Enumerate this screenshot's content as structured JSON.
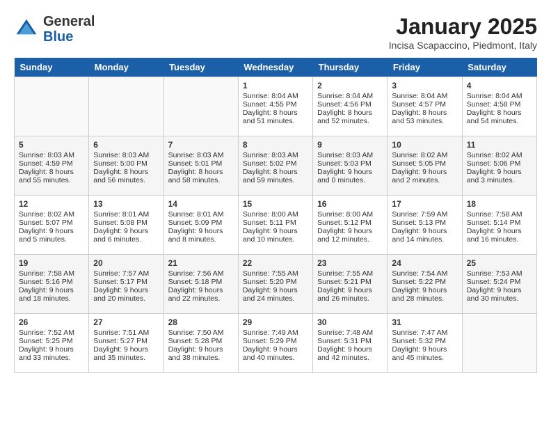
{
  "header": {
    "logo_general": "General",
    "logo_blue": "Blue",
    "month_title": "January 2025",
    "location": "Incisa Scapaccino, Piedmont, Italy"
  },
  "days_of_week": [
    "Sunday",
    "Monday",
    "Tuesday",
    "Wednesday",
    "Thursday",
    "Friday",
    "Saturday"
  ],
  "weeks": [
    [
      {
        "day": "",
        "info": ""
      },
      {
        "day": "",
        "info": ""
      },
      {
        "day": "",
        "info": ""
      },
      {
        "day": "1",
        "info": "Sunrise: 8:04 AM\nSunset: 4:55 PM\nDaylight: 8 hours and 51 minutes."
      },
      {
        "day": "2",
        "info": "Sunrise: 8:04 AM\nSunset: 4:56 PM\nDaylight: 8 hours and 52 minutes."
      },
      {
        "day": "3",
        "info": "Sunrise: 8:04 AM\nSunset: 4:57 PM\nDaylight: 8 hours and 53 minutes."
      },
      {
        "day": "4",
        "info": "Sunrise: 8:04 AM\nSunset: 4:58 PM\nDaylight: 8 hours and 54 minutes."
      }
    ],
    [
      {
        "day": "5",
        "info": "Sunrise: 8:03 AM\nSunset: 4:59 PM\nDaylight: 8 hours and 55 minutes."
      },
      {
        "day": "6",
        "info": "Sunrise: 8:03 AM\nSunset: 5:00 PM\nDaylight: 8 hours and 56 minutes."
      },
      {
        "day": "7",
        "info": "Sunrise: 8:03 AM\nSunset: 5:01 PM\nDaylight: 8 hours and 58 minutes."
      },
      {
        "day": "8",
        "info": "Sunrise: 8:03 AM\nSunset: 5:02 PM\nDaylight: 8 hours and 59 minutes."
      },
      {
        "day": "9",
        "info": "Sunrise: 8:03 AM\nSunset: 5:03 PM\nDaylight: 9 hours and 0 minutes."
      },
      {
        "day": "10",
        "info": "Sunrise: 8:02 AM\nSunset: 5:05 PM\nDaylight: 9 hours and 2 minutes."
      },
      {
        "day": "11",
        "info": "Sunrise: 8:02 AM\nSunset: 5:06 PM\nDaylight: 9 hours and 3 minutes."
      }
    ],
    [
      {
        "day": "12",
        "info": "Sunrise: 8:02 AM\nSunset: 5:07 PM\nDaylight: 9 hours and 5 minutes."
      },
      {
        "day": "13",
        "info": "Sunrise: 8:01 AM\nSunset: 5:08 PM\nDaylight: 9 hours and 6 minutes."
      },
      {
        "day": "14",
        "info": "Sunrise: 8:01 AM\nSunset: 5:09 PM\nDaylight: 9 hours and 8 minutes."
      },
      {
        "day": "15",
        "info": "Sunrise: 8:00 AM\nSunset: 5:11 PM\nDaylight: 9 hours and 10 minutes."
      },
      {
        "day": "16",
        "info": "Sunrise: 8:00 AM\nSunset: 5:12 PM\nDaylight: 9 hours and 12 minutes."
      },
      {
        "day": "17",
        "info": "Sunrise: 7:59 AM\nSunset: 5:13 PM\nDaylight: 9 hours and 14 minutes."
      },
      {
        "day": "18",
        "info": "Sunrise: 7:58 AM\nSunset: 5:14 PM\nDaylight: 9 hours and 16 minutes."
      }
    ],
    [
      {
        "day": "19",
        "info": "Sunrise: 7:58 AM\nSunset: 5:16 PM\nDaylight: 9 hours and 18 minutes."
      },
      {
        "day": "20",
        "info": "Sunrise: 7:57 AM\nSunset: 5:17 PM\nDaylight: 9 hours and 20 minutes."
      },
      {
        "day": "21",
        "info": "Sunrise: 7:56 AM\nSunset: 5:18 PM\nDaylight: 9 hours and 22 minutes."
      },
      {
        "day": "22",
        "info": "Sunrise: 7:55 AM\nSunset: 5:20 PM\nDaylight: 9 hours and 24 minutes."
      },
      {
        "day": "23",
        "info": "Sunrise: 7:55 AM\nSunset: 5:21 PM\nDaylight: 9 hours and 26 minutes."
      },
      {
        "day": "24",
        "info": "Sunrise: 7:54 AM\nSunset: 5:22 PM\nDaylight: 9 hours and 28 minutes."
      },
      {
        "day": "25",
        "info": "Sunrise: 7:53 AM\nSunset: 5:24 PM\nDaylight: 9 hours and 30 minutes."
      }
    ],
    [
      {
        "day": "26",
        "info": "Sunrise: 7:52 AM\nSunset: 5:25 PM\nDaylight: 9 hours and 33 minutes."
      },
      {
        "day": "27",
        "info": "Sunrise: 7:51 AM\nSunset: 5:27 PM\nDaylight: 9 hours and 35 minutes."
      },
      {
        "day": "28",
        "info": "Sunrise: 7:50 AM\nSunset: 5:28 PM\nDaylight: 9 hours and 38 minutes."
      },
      {
        "day": "29",
        "info": "Sunrise: 7:49 AM\nSunset: 5:29 PM\nDaylight: 9 hours and 40 minutes."
      },
      {
        "day": "30",
        "info": "Sunrise: 7:48 AM\nSunset: 5:31 PM\nDaylight: 9 hours and 42 minutes."
      },
      {
        "day": "31",
        "info": "Sunrise: 7:47 AM\nSunset: 5:32 PM\nDaylight: 9 hours and 45 minutes."
      },
      {
        "day": "",
        "info": ""
      }
    ]
  ]
}
